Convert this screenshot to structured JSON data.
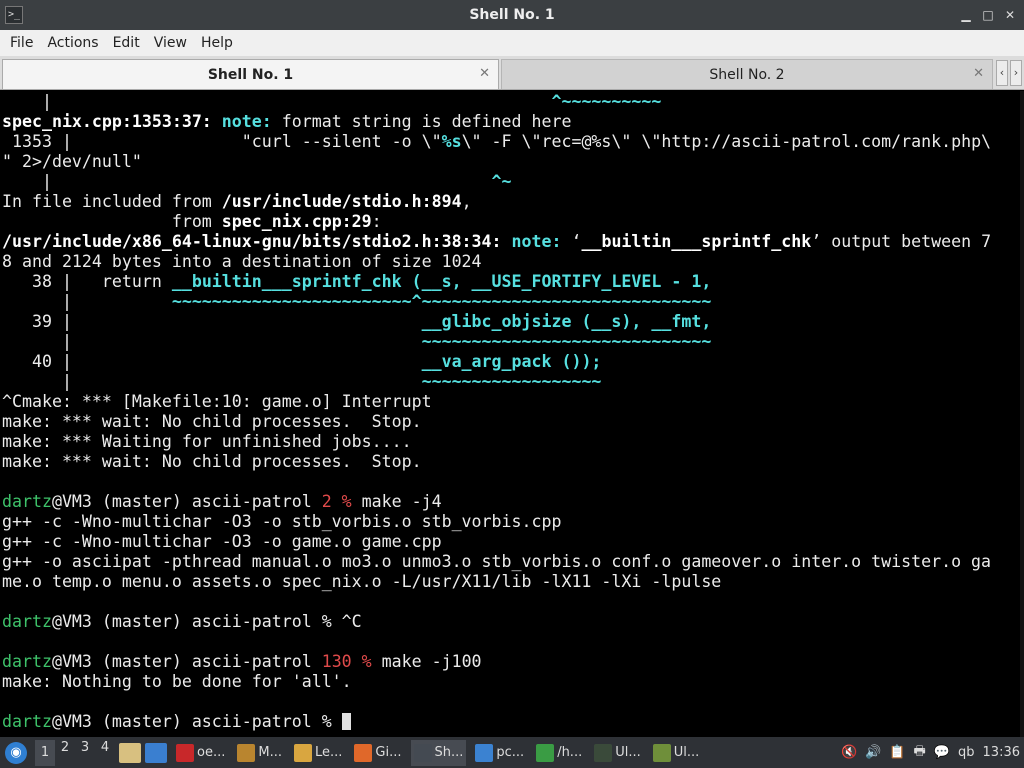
{
  "window": {
    "title": "Shell No. 1",
    "controls": [
      "minimize-icon",
      "maximize-icon",
      "close-icon"
    ]
  },
  "menu": [
    "File",
    "Actions",
    "Edit",
    "View",
    "Help"
  ],
  "tabs": [
    {
      "label": "Shell No. 1",
      "active": true
    },
    {
      "label": "Shell No. 2",
      "active": false
    }
  ],
  "terminal": {
    "lines": [
      {
        "spans": [
          {
            "t": "    |",
            "s": "w"
          },
          {
            "t": "                          ",
            "s": "w"
          },
          {
            "t": "                        ^~~~~~~~~~~",
            "s": "cb"
          }
        ]
      },
      {
        "spans": [
          {
            "t": "spec_nix.cpp:1353:37: ",
            "s": "b"
          },
          {
            "t": "note: ",
            "s": "cb"
          },
          {
            "t": "format string is defined here",
            "s": "w"
          }
        ]
      },
      {
        "spans": [
          {
            "t": " 1353 |                 \"curl --silent -o \\\"",
            "s": "w"
          },
          {
            "t": "%s",
            "s": "cb"
          },
          {
            "t": "\\\" -F \\\"rec=@%s\\\" \\\"http://ascii-patrol.com/rank.php\\",
            "s": "w"
          }
        ]
      },
      {
        "spans": [
          {
            "t": "\" 2>/dev/null\"",
            "s": "w"
          }
        ]
      },
      {
        "spans": [
          {
            "t": "    |",
            "s": "w"
          },
          {
            "t": "                                            ^~",
            "s": "cb"
          }
        ]
      },
      {
        "spans": [
          {
            "t": "In file included from ",
            "s": "w"
          },
          {
            "t": "/usr/include/stdio.h:894",
            "s": "b"
          },
          {
            "t": ",",
            "s": "w"
          }
        ]
      },
      {
        "spans": [
          {
            "t": "                 from ",
            "s": "w"
          },
          {
            "t": "spec_nix.cpp:29",
            "s": "b"
          },
          {
            "t": ":",
            "s": "w"
          }
        ]
      },
      {
        "spans": [
          {
            "t": "/usr/include/x86_64-linux-gnu/bits/stdio2.h:38:34: ",
            "s": "b"
          },
          {
            "t": "note: ",
            "s": "cb"
          },
          {
            "t": "‘",
            "s": "w"
          },
          {
            "t": "__builtin___sprintf_chk",
            "s": "b"
          },
          {
            "t": "’ output between 7",
            "s": "w"
          }
        ]
      },
      {
        "spans": [
          {
            "t": "8 and 2124 bytes into a destination of size 1024",
            "s": "w"
          }
        ]
      },
      {
        "spans": [
          {
            "t": "   38 |   return ",
            "s": "w"
          },
          {
            "t": "__builtin___sprintf_chk (__s, __USE_FORTIFY_LEVEL - 1,",
            "s": "cb"
          }
        ]
      },
      {
        "spans": [
          {
            "t": "      |",
            "s": "w"
          },
          {
            "t": "          ~~~~~~~~~~~~~~~~~~~~~~~~^~~~~~~~~~~~~~~~~~~~~~~~~~~~~~",
            "s": "cb"
          }
        ]
      },
      {
        "spans": [
          {
            "t": "   39 |                                   ",
            "s": "w"
          },
          {
            "t": "__glibc_objsize (__s), __fmt,",
            "s": "cb"
          }
        ]
      },
      {
        "spans": [
          {
            "t": "      |",
            "s": "w"
          },
          {
            "t": "                                   ~~~~~~~~~~~~~~~~~~~~~~~~~~~~~",
            "s": "cb"
          }
        ]
      },
      {
        "spans": [
          {
            "t": "   40 |                                   ",
            "s": "w"
          },
          {
            "t": "__va_arg_pack ());",
            "s": "cb"
          }
        ]
      },
      {
        "spans": [
          {
            "t": "      |",
            "s": "w"
          },
          {
            "t": "                                   ~~~~~~~~~~~~~~~~~~",
            "s": "cb"
          }
        ]
      },
      {
        "spans": [
          {
            "t": "^Cmake: *** [Makefile:10: game.o] Interrupt",
            "s": "w"
          }
        ]
      },
      {
        "spans": [
          {
            "t": "make: *** wait: No child processes.  Stop.",
            "s": "w"
          }
        ]
      },
      {
        "spans": [
          {
            "t": "make: *** Waiting for unfinished jobs....",
            "s": "w"
          }
        ]
      },
      {
        "spans": [
          {
            "t": "make: *** wait: No child processes.  Stop.",
            "s": "w"
          }
        ]
      },
      {
        "spans": [
          {
            "t": "",
            "s": "w"
          }
        ]
      },
      {
        "spans": [
          {
            "t": "dartz",
            "s": "g"
          },
          {
            "t": "@VM3 (master) ascii-patrol ",
            "s": "w"
          },
          {
            "t": "2 %",
            "s": "r"
          },
          {
            "t": " make -j4",
            "s": "w"
          }
        ]
      },
      {
        "spans": [
          {
            "t": "g++ -c -Wno-multichar -O3 -o stb_vorbis.o stb_vorbis.cpp",
            "s": "w"
          }
        ]
      },
      {
        "spans": [
          {
            "t": "g++ -c -Wno-multichar -O3 -o game.o game.cpp",
            "s": "w"
          }
        ]
      },
      {
        "spans": [
          {
            "t": "g++ -o asciipat -pthread manual.o mo3.o unmo3.o stb_vorbis.o conf.o gameover.o inter.o twister.o ga",
            "s": "w"
          }
        ]
      },
      {
        "spans": [
          {
            "t": "me.o temp.o menu.o assets.o spec_nix.o -L/usr/X11/lib -lX11 -lXi -lpulse",
            "s": "w"
          }
        ]
      },
      {
        "spans": [
          {
            "t": "",
            "s": "w"
          }
        ]
      },
      {
        "spans": [
          {
            "t": "dartz",
            "s": "g"
          },
          {
            "t": "@VM3 (master) ascii-patrol % ^C",
            "s": "w"
          }
        ]
      },
      {
        "spans": [
          {
            "t": "",
            "s": "w"
          }
        ]
      },
      {
        "spans": [
          {
            "t": "dartz",
            "s": "g"
          },
          {
            "t": "@VM3 (master) ascii-patrol ",
            "s": "w"
          },
          {
            "t": "130 %",
            "s": "r"
          },
          {
            "t": " make -j100",
            "s": "w"
          }
        ]
      },
      {
        "spans": [
          {
            "t": "make: Nothing to be done for 'all'.",
            "s": "w"
          }
        ]
      },
      {
        "spans": [
          {
            "t": "",
            "s": "w"
          }
        ]
      },
      {
        "spans": [
          {
            "t": "dartz",
            "s": "g"
          },
          {
            "t": "@VM3 (master) ascii-patrol % ",
            "s": "w"
          }
        ],
        "cursor": true
      }
    ]
  },
  "taskbar": {
    "workspaces": [
      "1",
      "2",
      "3",
      "4"
    ],
    "active_workspace": "1",
    "tasks": [
      {
        "label": "oe...",
        "icon": "filezilla-icon",
        "color": "#c8282a"
      },
      {
        "label": "M...",
        "icon": "package-icon",
        "color": "#b9852f"
      },
      {
        "label": "Le...",
        "icon": "document-icon",
        "color": "#d9a640"
      },
      {
        "label": "Gi...",
        "icon": "firefox-icon",
        "color": "#e0682a"
      },
      {
        "label": "Sh...",
        "icon": "terminal-icon",
        "color": "#444a52",
        "active": true
      },
      {
        "label": "pc...",
        "icon": "folder-icon",
        "color": "#3b82d1"
      },
      {
        "label": "/h...",
        "icon": "editor-icon",
        "color": "#3a9c44"
      },
      {
        "label": "Ul...",
        "icon": "monitor-icon",
        "color": "#3a4a3a"
      },
      {
        "label": "Ul...",
        "icon": "minecraft-icon",
        "color": "#6f8f3a"
      }
    ],
    "clock": "13:36",
    "tray_text": "qb"
  }
}
